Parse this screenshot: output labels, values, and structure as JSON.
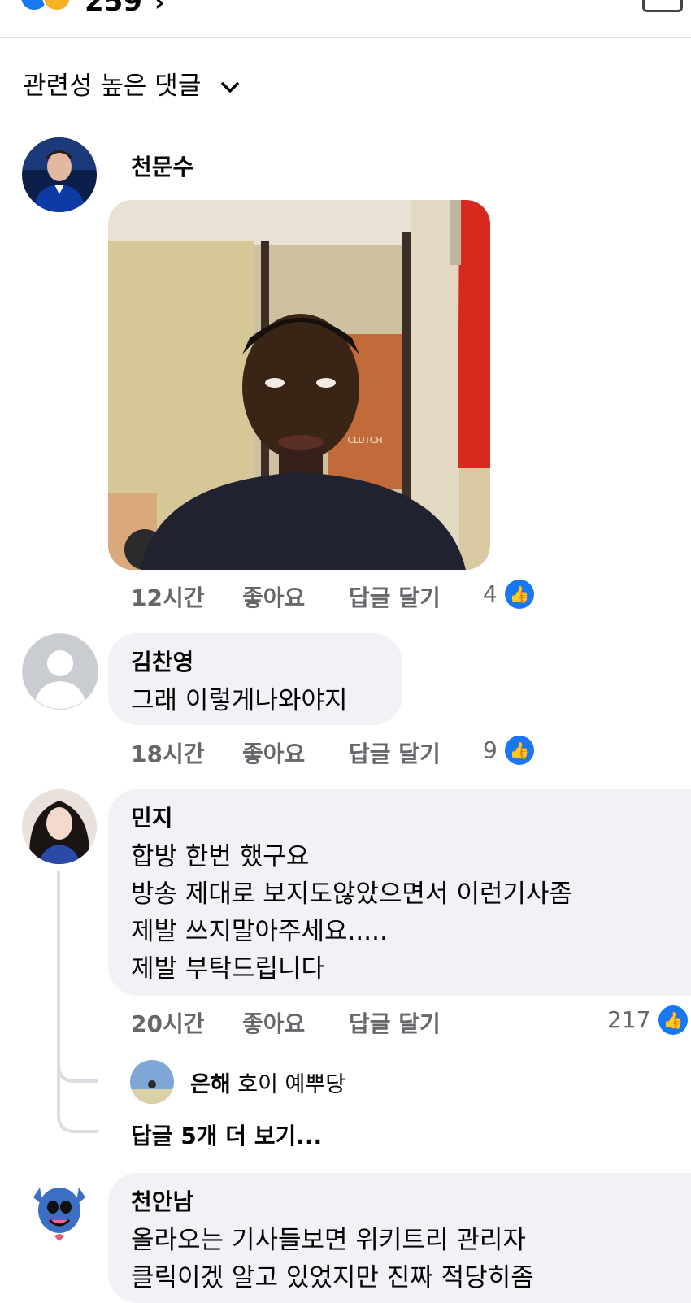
{
  "header": {
    "reaction_count": "259",
    "chevron": "›"
  },
  "sort": {
    "label": "관련성 높은 댓글",
    "chevron": "⌄"
  },
  "comments": [
    {
      "name": "천문수",
      "time": "12시간",
      "like_action": "좋아요",
      "reply_action": "답글 달기",
      "likes": "4"
    },
    {
      "name": "김찬영",
      "text": "그래 이렇게나와야지",
      "time": "18시간",
      "like_action": "좋아요",
      "reply_action": "답글 달기",
      "likes": "9"
    },
    {
      "name": "민지",
      "text": "합방 한번 했구요\n방송 제대로 보지도않았으면서 이런기사좀\n제발 쓰지말아주세요.....\n제발 부탁드립니다",
      "time": "20시간",
      "like_action": "좋아요",
      "reply_action": "답글 달기",
      "likes": "217",
      "reply_preview": {
        "name": "은해",
        "text": "호이 예뿌당"
      },
      "more_replies": "답글 5개 더 보기..."
    },
    {
      "name": "천안남",
      "text": "올라오는 기사들보면 위키트리 관리자\n클릭이겠 알고 있었지만 진짜 적당히좀"
    }
  ],
  "image_sign_text": "CLUTCH",
  "colors": {
    "accent": "#1877f2",
    "bubble": "#f0f2f5",
    "secondary_text": "#65676b"
  }
}
